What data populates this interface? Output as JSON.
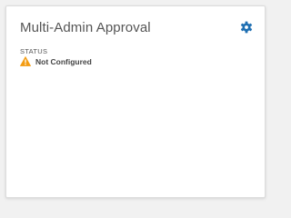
{
  "card": {
    "title": "Multi-Admin Approval",
    "settings_icon": "gear-icon",
    "status_label": "STATUS",
    "status_value": "Not Configured",
    "status_icon": "warning-triangle-icon"
  },
  "colors": {
    "accent": "#1f6fb2",
    "warning": "#f39c12",
    "background": "#f1f1f1",
    "card": "#ffffff"
  }
}
